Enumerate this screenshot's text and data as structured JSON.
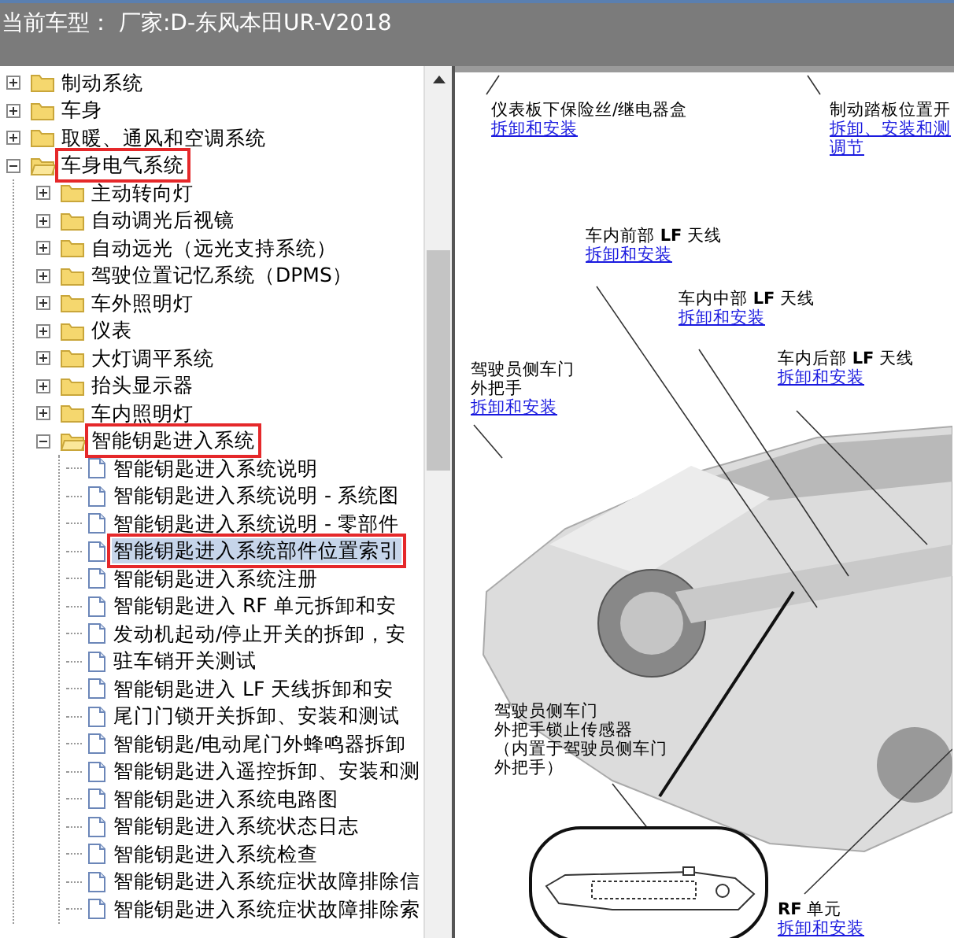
{
  "title_bar": {
    "text": "当前车型：  厂家:D-东风本田UR-V2018"
  },
  "tree": [
    {
      "label": "制动系统",
      "kind": "folder",
      "expanded": false,
      "selected": false,
      "highlighted": false
    },
    {
      "label": "车身",
      "kind": "folder",
      "expanded": false,
      "selected": false,
      "highlighted": false
    },
    {
      "label": "取暖、通风和空调系统",
      "kind": "folder",
      "expanded": false,
      "selected": false,
      "highlighted": false
    },
    {
      "label": "车身电气系统",
      "kind": "folder",
      "expanded": true,
      "selected": false,
      "highlighted": true,
      "children": [
        {
          "label": "主动转向灯",
          "kind": "folder",
          "expanded": false,
          "selected": false,
          "highlighted": false
        },
        {
          "label": "自动调光后视镜",
          "kind": "folder",
          "expanded": false,
          "selected": false,
          "highlighted": false
        },
        {
          "label": "自动远光（远光支持系统）",
          "kind": "folder",
          "expanded": false,
          "selected": false,
          "highlighted": false
        },
        {
          "label": "驾驶位置记忆系统（DPMS）",
          "kind": "folder",
          "expanded": false,
          "selected": false,
          "highlighted": false
        },
        {
          "label": "车外照明灯",
          "kind": "folder",
          "expanded": false,
          "selected": false,
          "highlighted": false
        },
        {
          "label": "仪表",
          "kind": "folder",
          "expanded": false,
          "selected": false,
          "highlighted": false
        },
        {
          "label": "大灯调平系统",
          "kind": "folder",
          "expanded": false,
          "selected": false,
          "highlighted": false
        },
        {
          "label": "抬头显示器",
          "kind": "folder",
          "expanded": false,
          "selected": false,
          "highlighted": false
        },
        {
          "label": "车内照明灯",
          "kind": "folder",
          "expanded": false,
          "selected": false,
          "highlighted": false
        },
        {
          "label": "智能钥匙进入系统",
          "kind": "folder",
          "expanded": true,
          "selected": false,
          "highlighted": true,
          "children": [
            {
              "label": "智能钥匙进入系统说明",
              "kind": "doc",
              "selected": false,
              "highlighted": false
            },
            {
              "label": "智能钥匙进入系统说明 - 系统图",
              "kind": "doc",
              "selected": false,
              "highlighted": false
            },
            {
              "label": "智能钥匙进入系统说明 - 零部件",
              "kind": "doc",
              "selected": false,
              "highlighted": false
            },
            {
              "label": "智能钥匙进入系统部件位置索引",
              "kind": "doc",
              "selected": true,
              "highlighted": true
            },
            {
              "label": "智能钥匙进入系统注册",
              "kind": "doc",
              "selected": false,
              "highlighted": false
            },
            {
              "label": "智能钥匙进入 RF 单元拆卸和安",
              "kind": "doc",
              "selected": false,
              "highlighted": false
            },
            {
              "label": "发动机起动/停止开关的拆卸，安",
              "kind": "doc",
              "selected": false,
              "highlighted": false
            },
            {
              "label": "驻车销开关测试",
              "kind": "doc",
              "selected": false,
              "highlighted": false
            },
            {
              "label": "智能钥匙进入 LF 天线拆卸和安",
              "kind": "doc",
              "selected": false,
              "highlighted": false
            },
            {
              "label": "尾门门锁开关拆卸、安装和测试",
              "kind": "doc",
              "selected": false,
              "highlighted": false
            },
            {
              "label": "智能钥匙/电动尾门外蜂鸣器拆卸",
              "kind": "doc",
              "selected": false,
              "highlighted": false
            },
            {
              "label": "智能钥匙进入遥控拆卸、安装和测",
              "kind": "doc",
              "selected": false,
              "highlighted": false
            },
            {
              "label": "智能钥匙进入系统电路图",
              "kind": "doc",
              "selected": false,
              "highlighted": false
            },
            {
              "label": "智能钥匙进入系统状态日志",
              "kind": "doc",
              "selected": false,
              "highlighted": false
            },
            {
              "label": "智能钥匙进入系统检查",
              "kind": "doc",
              "selected": false,
              "highlighted": false
            },
            {
              "label": "智能钥匙进入系统症状故障排除信",
              "kind": "doc",
              "selected": false,
              "highlighted": false
            },
            {
              "label": "智能钥匙进入系统症状故障排除索",
              "kind": "doc",
              "selected": false,
              "highlighted": false
            }
          ]
        }
      ]
    }
  ],
  "diagram": {
    "callouts": [
      {
        "lines": [
          "仪表板下保险丝/继电器盒"
        ],
        "links": [
          "拆卸和安装"
        ]
      },
      {
        "lines": [
          "制动踏板位置开"
        ],
        "links": [
          "拆卸、安装和测",
          "调节"
        ]
      },
      {
        "lines": [
          "车内前部 **LF** 天线"
        ],
        "links": [
          "拆卸和安装"
        ]
      },
      {
        "lines": [
          "车内中部 **LF** 天线"
        ],
        "links": [
          "拆卸和安装"
        ]
      },
      {
        "lines": [
          "车内后部 **LF** 天线"
        ],
        "links": [
          "拆卸和安装"
        ]
      },
      {
        "lines": [
          "驾驶员侧车门",
          "外把手"
        ],
        "links": [
          "拆卸和安装"
        ]
      },
      {
        "lines": [
          "驾驶员侧车门",
          "外把手锁止传感器",
          "（内置于驾驶员侧车门",
          "外把手）"
        ]
      },
      {
        "lines": [
          "**RF** 单元"
        ],
        "links": [
          "拆卸和安装"
        ]
      }
    ]
  }
}
